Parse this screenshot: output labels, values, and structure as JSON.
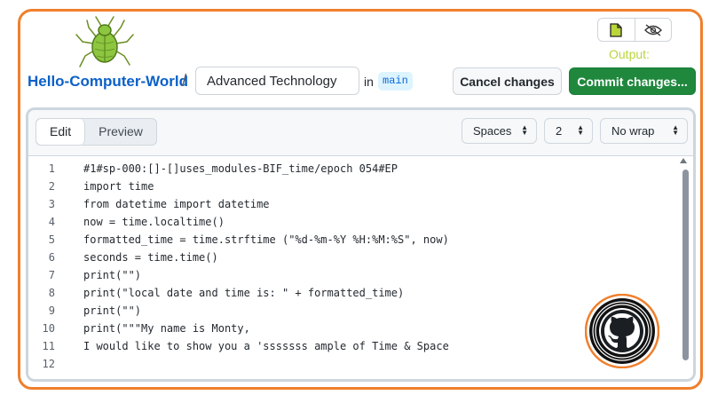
{
  "header": {
    "repo_name": "Hello-Computer-World",
    "separator": "/",
    "filename": "Advanced Technology",
    "in_label": "in",
    "branch": "main",
    "output_label": "Output:",
    "cancel_label": "Cancel changes",
    "commit_label": "Commit changes..."
  },
  "icons": {
    "logo": "bug-logo-icon",
    "file_toggle": "file-icon",
    "hide_toggle": "eye-slash-icon",
    "badge": "github-octocat-icon"
  },
  "toolbar": {
    "tabs": [
      {
        "label": "Edit",
        "active": true
      },
      {
        "label": "Preview",
        "active": false
      }
    ],
    "indent_mode": "Spaces",
    "indent_size": "2",
    "wrap_mode": "No wrap"
  },
  "code_lines": [
    {
      "num": "1",
      "text": "#1#sp-000:[]-[]uses_modules-BIF_time/epoch 054#EP"
    },
    {
      "num": "2",
      "text": "import time"
    },
    {
      "num": "3",
      "text": "from datetime import datetime"
    },
    {
      "num": "4",
      "text": "now = time.localtime()"
    },
    {
      "num": "5",
      "text": "formatted_time = time.strftime (\"%d-%m-%Y %H:%M:%S\", now)"
    },
    {
      "num": "6",
      "text": "seconds = time.time()"
    },
    {
      "num": "7",
      "text": "print(\"\")"
    },
    {
      "num": "8",
      "text": "print(\"local date and time is: \" + formatted_time)"
    },
    {
      "num": "9",
      "text": "print(\"\")"
    },
    {
      "num": "10",
      "text": "print(\"\"\"My name is Monty,"
    },
    {
      "num": "11",
      "text": "I would like to show you a 'sssssss ample of Time & Space"
    },
    {
      "num": "12",
      "text": ""
    }
  ],
  "colors": {
    "frame_border": "#f07f2c",
    "commit_green": "#1f883d",
    "repo_link": "#0b60c8",
    "output_label": "#b9d63a",
    "logo_green": "#8dc63f"
  }
}
